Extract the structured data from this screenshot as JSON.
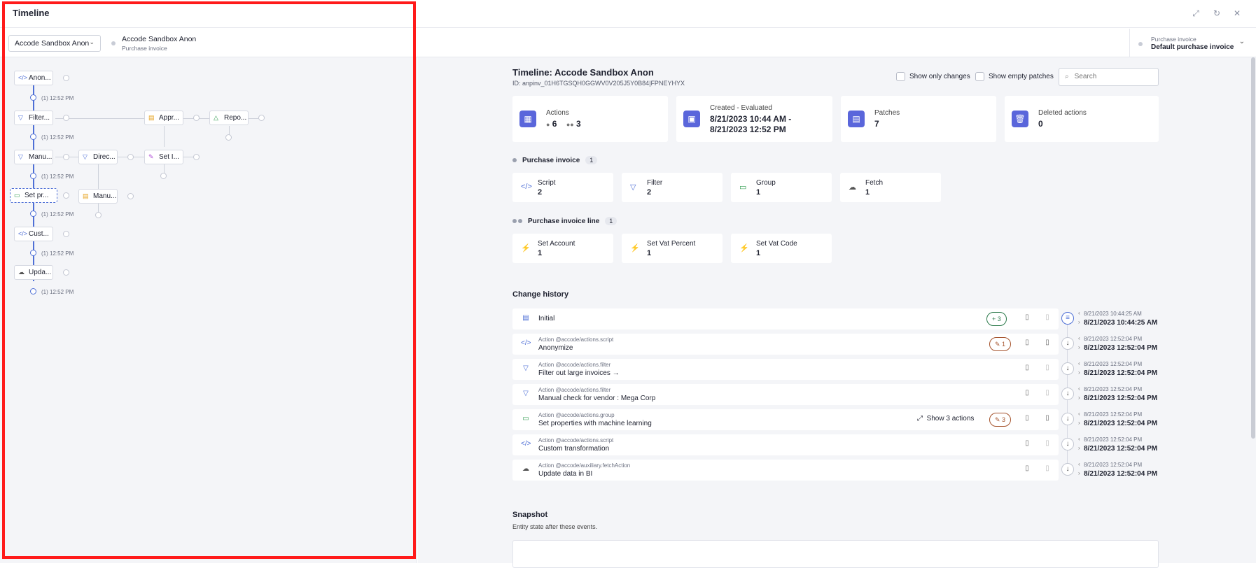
{
  "window": {
    "title": "Timeline"
  },
  "toolbar": {
    "entity_select": "Accode Sandbox Anon",
    "entity_name": "Accode Sandbox Anon",
    "entity_type": "Purchase invoice",
    "right_label": "Purchase invoice",
    "right_value": "Default purchase invoice"
  },
  "graph": {
    "nodes": [
      {
        "label": "Anon...",
        "icon": "</>"
      },
      {
        "label": "Filter...",
        "icon": "▽"
      },
      {
        "label": "Appr...",
        "icon": "▤"
      },
      {
        "label": "Repo...",
        "icon": "△"
      },
      {
        "label": "Manu...",
        "icon": "▽"
      },
      {
        "label": "Direc...",
        "icon": "▽"
      },
      {
        "label": "Set I...",
        "icon": "✎"
      },
      {
        "label": "Set pr...",
        "icon": "▭"
      },
      {
        "label": "Manu...",
        "icon": "▤"
      },
      {
        "label": "Cust...",
        "icon": "</>"
      },
      {
        "label": "Upda...",
        "icon": "☁"
      }
    ],
    "times": [
      "(1) 12:52 PM",
      "(1) 12:52 PM",
      "(1) 12:52 PM",
      "(1) 12:52 PM",
      "(1) 12:52 PM",
      "(1) 12:52 PM"
    ]
  },
  "header": {
    "title": "Timeline: Accode Sandbox Anon",
    "id": "ID: anpinv_01H6TGSQH0GGWV0V205J5Y0B84|FPNEYHYX",
    "show_changes": "Show only changes",
    "show_empty": "Show empty patches",
    "search_placeholder": "Search"
  },
  "stats": [
    {
      "label": "Actions",
      "value_a": "6",
      "value_b": "3",
      "icon": "grid-icon"
    },
    {
      "label": "Created - Evaluated",
      "value": "8/21/2023 10:44 AM -",
      "value2": "8/21/2023 12:52 PM",
      "icon": "calendar-icon"
    },
    {
      "label": "Patches",
      "value": "7",
      "icon": "clipboard-icon"
    },
    {
      "label": "Deleted actions",
      "value": "0",
      "icon": "trash-icon"
    }
  ],
  "purchase_invoice": {
    "title": "Purchase invoice",
    "count": "1",
    "cards": [
      {
        "label": "Script",
        "value": "2",
        "icon": "</>"
      },
      {
        "label": "Filter",
        "value": "2",
        "icon": "▽"
      },
      {
        "label": "Group",
        "value": "1",
        "icon": "▭"
      },
      {
        "label": "Fetch",
        "value": "1",
        "icon": "☁"
      }
    ]
  },
  "purchase_invoice_line": {
    "title": "Purchase invoice line",
    "count": "1",
    "cards": [
      {
        "label": "Set Account",
        "value": "1",
        "icon": "⚡"
      },
      {
        "label": "Set Vat Percent",
        "value": "1",
        "icon": "⚡"
      },
      {
        "label": "Set Vat Code",
        "value": "1",
        "icon": "⚡"
      }
    ]
  },
  "history": {
    "title": "Change history",
    "rows": [
      {
        "sub": "",
        "main": "Initial",
        "pill": "+ 3",
        "icon": "▤",
        "ts1": "8/21/2023 10:44:25 AM",
        "ts2": "8/21/2023 10:44:25 AM"
      },
      {
        "sub": "Action @accode/actions.script",
        "main": "Anonymize",
        "pill": "✎ 1",
        "icon": "</>",
        "ts1": "8/21/2023 12:52:04 PM",
        "ts2": "8/21/2023 12:52:04 PM"
      },
      {
        "sub": "Action @accode/actions.filter",
        "main": "Filter out large invoices →",
        "pill": "",
        "icon": "▽",
        "ts1": "8/21/2023 12:52:04 PM",
        "ts2": "8/21/2023 12:52:04 PM"
      },
      {
        "sub": "Action @accode/actions.filter",
        "main": "Manual check for vendor : Mega Corp",
        "pill": "",
        "icon": "▽",
        "ts1": "8/21/2023 12:52:04 PM",
        "ts2": "8/21/2023 12:52:04 PM"
      },
      {
        "sub": "Action @accode/actions.group",
        "main": "Set properties with machine learning",
        "pill": "✎ 3",
        "icon": "▭",
        "ts1": "8/21/2023 12:52:04 PM",
        "ts2": "8/21/2023 12:52:04 PM"
      },
      {
        "sub": "Action @accode/actions.script",
        "main": "Custom transformation",
        "pill": "",
        "icon": "</>",
        "ts1": "8/21/2023 12:52:04 PM",
        "ts2": "8/21/2023 12:52:04 PM"
      },
      {
        "sub": "Action @accode/auxiliary.fetchAction",
        "main": "Update data in BI",
        "pill": "",
        "icon": "☁",
        "ts1": "8/21/2023 12:52:04 PM",
        "ts2": "8/21/2023 12:52:04 PM"
      }
    ],
    "show_actions": "Show 3 actions"
  },
  "snapshot": {
    "title": "Snapshot",
    "subtitle": "Entity state after these events."
  },
  "colors": {
    "accent": "#5a66db",
    "frame": "#ff1a1a"
  }
}
